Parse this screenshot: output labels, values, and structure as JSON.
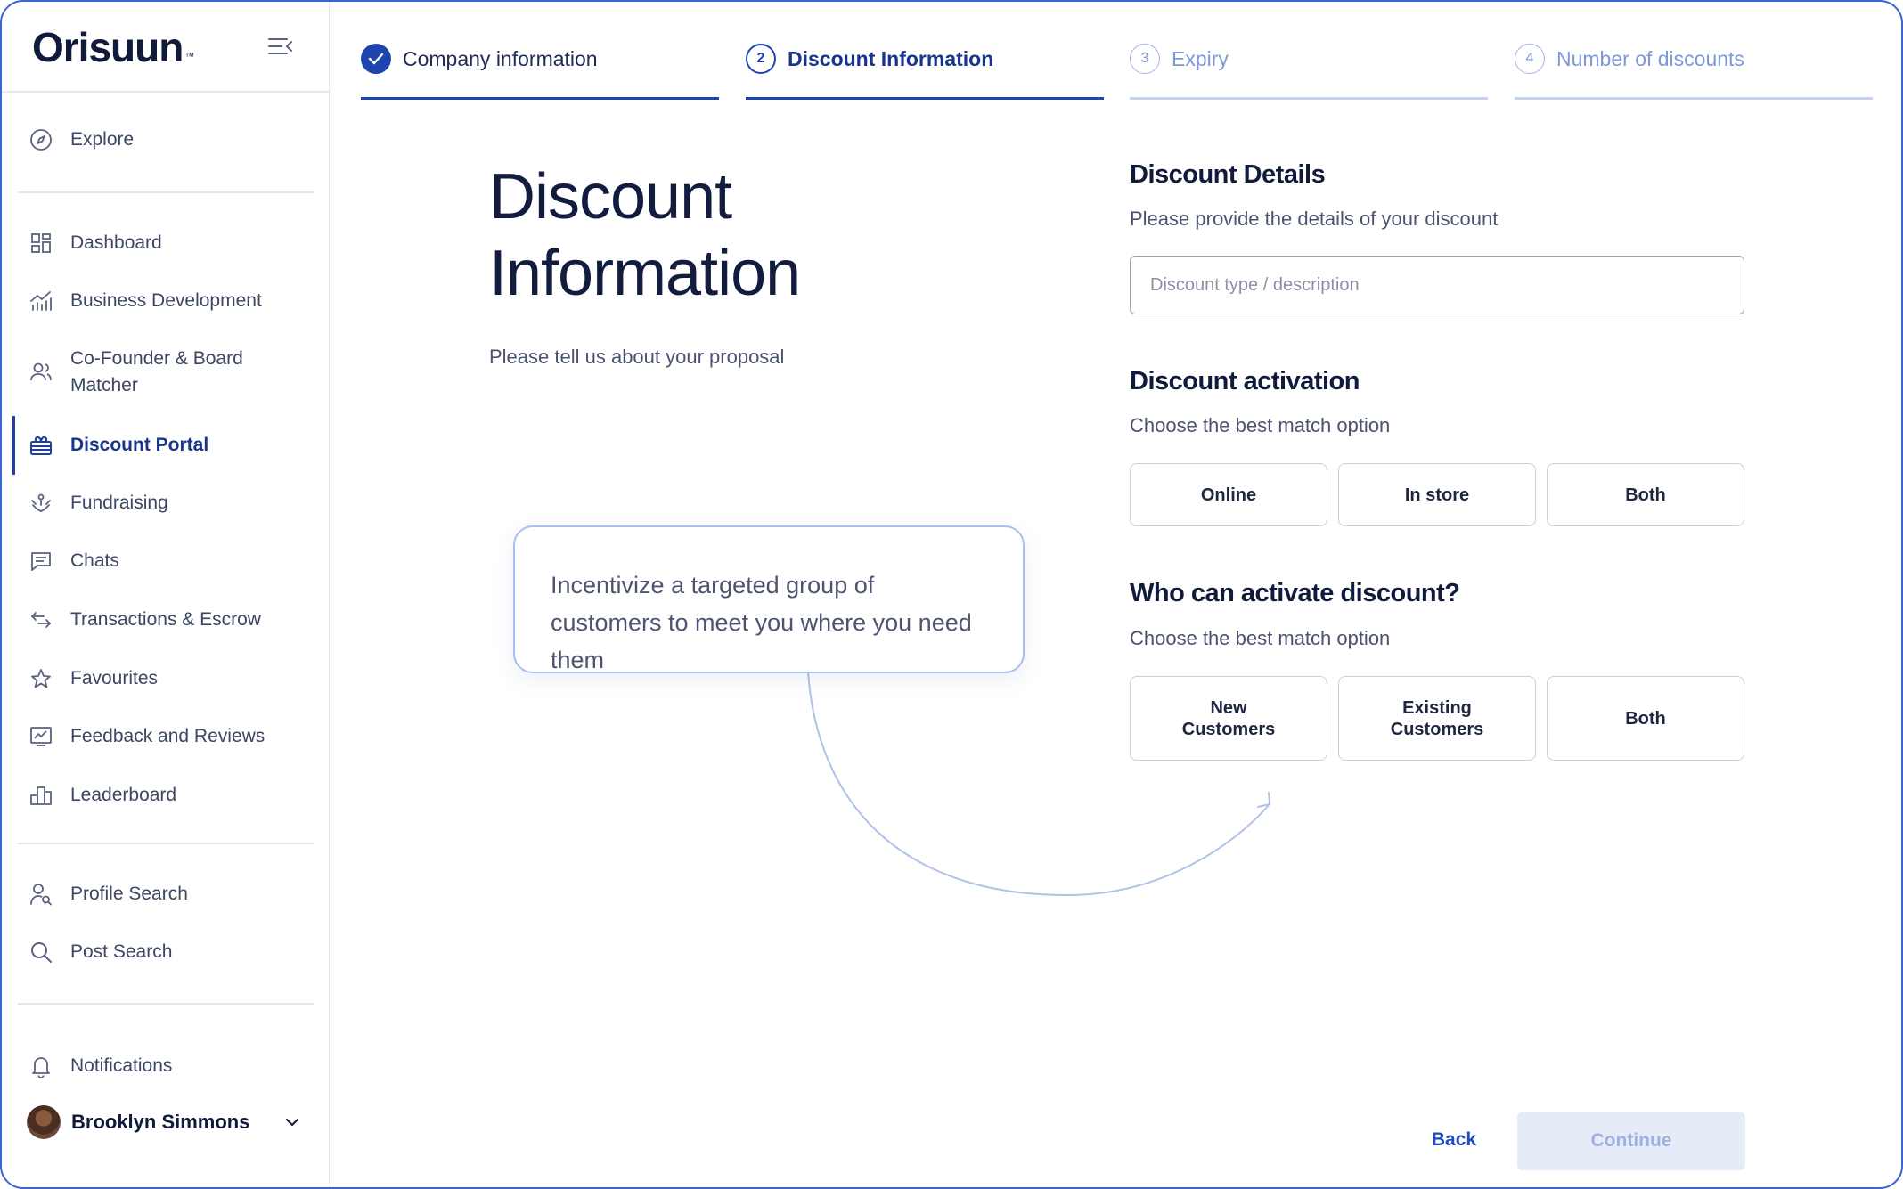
{
  "app": {
    "logo": "Orisuun",
    "logo_tm": "™"
  },
  "sidebar": {
    "items": [
      {
        "label": "Explore",
        "icon": "compass-icon"
      },
      {
        "label": "Dashboard",
        "icon": "dashboard-grid-icon"
      },
      {
        "label": "Business Development",
        "icon": "chart-growth-icon"
      },
      {
        "label": "Co-Founder & Board Matcher",
        "icon": "people-icon"
      },
      {
        "label": "Discount Portal",
        "icon": "gift-icon",
        "active": true
      },
      {
        "label": "Fundraising",
        "icon": "fundraising-icon"
      },
      {
        "label": "Chats",
        "icon": "chat-icon"
      },
      {
        "label": "Transactions & Escrow",
        "icon": "transfer-arrows-icon"
      },
      {
        "label": "Favourites",
        "icon": "star-icon"
      },
      {
        "label": "Feedback and Reviews",
        "icon": "feedback-icon"
      },
      {
        "label": "Leaderboard",
        "icon": "leaderboard-icon"
      },
      {
        "label": "Profile Search",
        "icon": "profile-search-icon"
      },
      {
        "label": "Post Search",
        "icon": "search-icon"
      },
      {
        "label": "Notifications",
        "icon": "bell-icon"
      }
    ],
    "user": {
      "name": "Brooklyn Simmons"
    }
  },
  "stepper": [
    {
      "number": "✓",
      "label": "Company information",
      "state": "done"
    },
    {
      "number": "2",
      "label": "Discount Information",
      "state": "current"
    },
    {
      "number": "3",
      "label": "Expiry",
      "state": "upcoming"
    },
    {
      "number": "4",
      "label": "Number of discounts",
      "state": "upcoming"
    }
  ],
  "intro": {
    "title_line1": "Discount",
    "title_line2": "Information",
    "subtitle": "Please tell us about your proposal",
    "callout": "Incentivize a targeted group of customers to meet you where you need them"
  },
  "form": {
    "details": {
      "title": "Discount Details",
      "subtitle": "Please provide the details of your discount",
      "placeholder": "Discount type / description",
      "value": ""
    },
    "activation": {
      "title": "Discount activation",
      "subtitle": "Choose the best match option",
      "options": [
        "Online",
        "In store",
        "Both"
      ]
    },
    "who": {
      "title": "Who can activate discount?",
      "subtitle": "Choose the best match option",
      "options": [
        "New Customers",
        "Existing Customers",
        "Both"
      ]
    }
  },
  "footer": {
    "back": "Back",
    "continue": "Continue"
  },
  "colors": {
    "accent": "#1f4bbf",
    "nav_active": "#18348c",
    "step_upcoming": "#7e97d8",
    "step_line_upcoming": "#c6d2f0",
    "continue_disabled_bg": "#e6ebf8",
    "frame_border": "#3a63d6"
  }
}
